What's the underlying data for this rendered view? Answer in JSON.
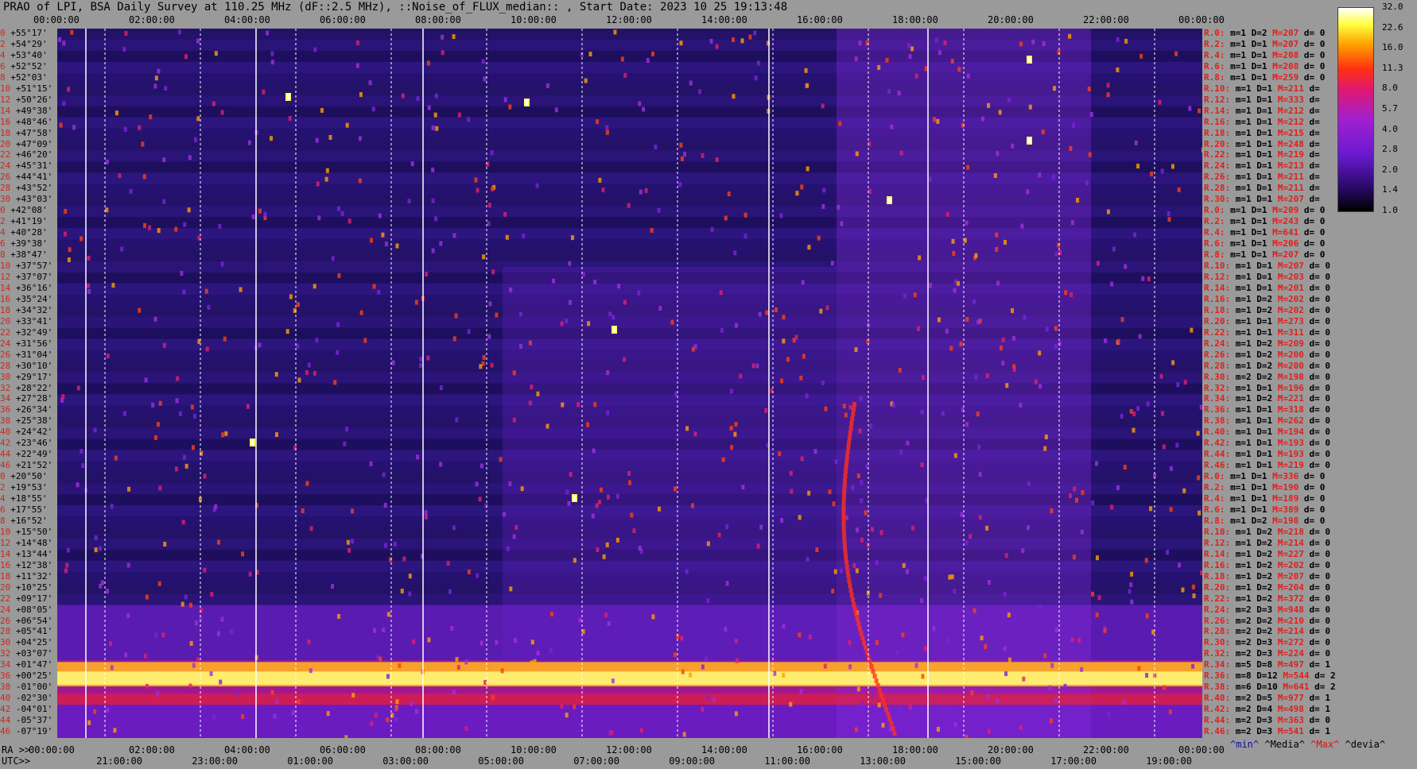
{
  "title": "PRAO of LPI, BSA Daily Survey at 110.25 MHz (dF::2.5 MHz), ::Noise_of_FLUX_median:: , Start Date: 2023 10 25 19:13:48",
  "top_ticks": [
    "00:00:00",
    "02:00:00",
    "04:00:00",
    "06:00:00",
    "08:00:00",
    "10:00:00",
    "12:00:00",
    "14:00:00",
    "16:00:00",
    "18:00:00",
    "20:00:00",
    "22:00:00",
    "00:00:00"
  ],
  "ra_prefix": "RA >>",
  "ra_ticks": [
    "00:00:00",
    "02:00:00",
    "04:00:00",
    "06:00:00",
    "08:00:00",
    "10:00:00",
    "12:00:00",
    "14:00:00",
    "16:00:00",
    "18:00:00",
    "20:00:00",
    "22:00:00",
    "00:00:00"
  ],
  "utc_prefix": "UTC>>",
  "utc_ticks": [
    "21:00:00",
    "23:00:00",
    "01:00:00",
    "03:00:00",
    "05:00:00",
    "07:00:00",
    "09:00:00",
    "11:00:00",
    "13:00:00",
    "15:00:00",
    "17:00:00",
    "19:00:00"
  ],
  "colorbar": {
    "labels": [
      "32.0",
      "22.6",
      "16.0",
      "11.3",
      "8.0",
      "5.7",
      "4.0",
      "2.8",
      "2.0",
      "1.4",
      "1.0"
    ]
  },
  "legend": {
    "min": "^min^",
    "median": "^Media^",
    "max": "^Max^",
    "dev": "^devia^"
  },
  "chart_data": {
    "type": "heatmap",
    "title": "PRAO of LPI, BSA Daily Survey at 110.25 MHz (dF::2.5 MHz), ::Noise_of_FLUX_median:: , Start Date: 2023 10 25 19:13:48",
    "x_ra_range": [
      "00:00:00",
      "00:00:00"
    ],
    "colorbar_range": [
      1.0,
      32.0
    ],
    "colorbar_scale": "log",
    "declinations": [
      "+55°17'",
      "+54°29'",
      "+53°40'",
      "+52°52'",
      "+52°03'",
      "+51°15'",
      "+50°26'",
      "+49°38'",
      "+48°46'",
      "+47°58'",
      "+47°09'",
      "+46°20'",
      "+45°31'",
      "+44°41'",
      "+43°52'",
      "+43°03'",
      "+42°08'",
      "+41°19'",
      "+40°28'",
      "+39°38'",
      "+38°47'",
      "+37°57'",
      "+37°07'",
      "+36°16'",
      "+35°24'",
      "+34°32'",
      "+33°41'",
      "+32°49'",
      "+31°56'",
      "+31°04'",
      "+30°10'",
      "+29°17'",
      "+28°22'",
      "+27°28'",
      "+26°34'",
      "+25°38'",
      "+24°42'",
      "+23°46'",
      "+22°49'",
      "+21°52'",
      "+20°50'",
      "+19°53'",
      "+18°55'",
      "+17°55'",
      "+16°52'",
      "+15°50'",
      "+14°48'",
      "+13°44'",
      "+12°38'",
      "+11°32'",
      "+10°25'",
      "+09°17'",
      "+08°05'",
      "+06°54'",
      "+05°41'",
      "+04°25'",
      "+03°07'",
      "+01°47'",
      "+00°25'",
      "-01°00'",
      "-02°30'",
      "-04°01'",
      "-05°37'",
      "-07°19'"
    ],
    "rows": [
      {
        "r": "R.0:",
        "m": "m=1",
        "d": "D=2",
        "M": "M=207",
        "dev": "d= 0"
      },
      {
        "r": "R.2:",
        "m": "m=1",
        "d": "D=1",
        "M": "M=207",
        "dev": "d= 0"
      },
      {
        "r": "R.4:",
        "m": "m=1",
        "d": "D=1",
        "M": "M=208",
        "dev": "d= 0"
      },
      {
        "r": "R.6:",
        "m": "m=1",
        "d": "D=1",
        "M": "M=208",
        "dev": "d= 0"
      },
      {
        "r": "R.8:",
        "m": "m=1",
        "d": "D=1",
        "M": "M=259",
        "dev": "d= 0"
      },
      {
        "r": "R.10:",
        "m": "m=1",
        "d": "D=1",
        "M": "M=211",
        "dev": "d="
      },
      {
        "r": "R.12:",
        "m": "m=1",
        "d": "D=1",
        "M": "M=333",
        "dev": "d="
      },
      {
        "r": "R.14:",
        "m": "m=1",
        "d": "D=1",
        "M": "M=212",
        "dev": "d="
      },
      {
        "r": "R.16:",
        "m": "m=1",
        "d": "D=1",
        "M": "M=212",
        "dev": "d="
      },
      {
        "r": "R.18:",
        "m": "m=1",
        "d": "D=1",
        "M": "M=215",
        "dev": "d="
      },
      {
        "r": "R.20:",
        "m": "m=1",
        "d": "D=1",
        "M": "M=248",
        "dev": "d="
      },
      {
        "r": "R.22:",
        "m": "m=1",
        "d": "D=1",
        "M": "M=219",
        "dev": "d="
      },
      {
        "r": "R.24:",
        "m": "m=1",
        "d": "D=1",
        "M": "M=213",
        "dev": "d="
      },
      {
        "r": "R.26:",
        "m": "m=1",
        "d": "D=1",
        "M": "M=211",
        "dev": "d="
      },
      {
        "r": "R.28:",
        "m": "m=1",
        "d": "D=1",
        "M": "M=211",
        "dev": "d="
      },
      {
        "r": "R.30:",
        "m": "m=1",
        "d": "D=1",
        "M": "M=207",
        "dev": "d="
      },
      {
        "r": "R.0:",
        "m": "m=1",
        "d": "D=1",
        "M": "M=209",
        "dev": "d= 0"
      },
      {
        "r": "R.2:",
        "m": "m=1",
        "d": "D=1",
        "M": "M=243",
        "dev": "d= 0"
      },
      {
        "r": "R.4:",
        "m": "m=1",
        "d": "D=1",
        "M": "M=641",
        "dev": "d= 0"
      },
      {
        "r": "R.6:",
        "m": "m=1",
        "d": "D=1",
        "M": "M=206",
        "dev": "d= 0"
      },
      {
        "r": "R.8:",
        "m": "m=1",
        "d": "D=1",
        "M": "M=207",
        "dev": "d= 0"
      },
      {
        "r": "R.10:",
        "m": "m=1",
        "d": "D=1",
        "M": "M=207",
        "dev": "d= 0"
      },
      {
        "r": "R.12:",
        "m": "m=1",
        "d": "D=1",
        "M": "M=203",
        "dev": "d= 0"
      },
      {
        "r": "R.14:",
        "m": "m=1",
        "d": "D=1",
        "M": "M=201",
        "dev": "d= 0"
      },
      {
        "r": "R.16:",
        "m": "m=1",
        "d": "D=2",
        "M": "M=202",
        "dev": "d= 0"
      },
      {
        "r": "R.18:",
        "m": "m=1",
        "d": "D=2",
        "M": "M=202",
        "dev": "d= 0"
      },
      {
        "r": "R.20:",
        "m": "m=1",
        "d": "D=1",
        "M": "M=273",
        "dev": "d= 0"
      },
      {
        "r": "R.22:",
        "m": "m=1",
        "d": "D=1",
        "M": "M=311",
        "dev": "d= 0"
      },
      {
        "r": "R.24:",
        "m": "m=1",
        "d": "D=2",
        "M": "M=209",
        "dev": "d= 0"
      },
      {
        "r": "R.26:",
        "m": "m=1",
        "d": "D=2",
        "M": "M=200",
        "dev": "d= 0"
      },
      {
        "r": "R.28:",
        "m": "m=1",
        "d": "D=2",
        "M": "M=200",
        "dev": "d= 0"
      },
      {
        "r": "R.30:",
        "m": "m=2",
        "d": "D=2",
        "M": "M=198",
        "dev": "d= 0"
      },
      {
        "r": "R.32:",
        "m": "m=1",
        "d": "D=1",
        "M": "M=196",
        "dev": "d= 0"
      },
      {
        "r": "R.34:",
        "m": "m=1",
        "d": "D=2",
        "M": "M=221",
        "dev": "d= 0"
      },
      {
        "r": "R.36:",
        "m": "m=1",
        "d": "D=1",
        "M": "M=318",
        "dev": "d= 0"
      },
      {
        "r": "R.38:",
        "m": "m=1",
        "d": "D=1",
        "M": "M=262",
        "dev": "d= 0"
      },
      {
        "r": "R.40:",
        "m": "m=1",
        "d": "D=1",
        "M": "M=194",
        "dev": "d= 0"
      },
      {
        "r": "R.42:",
        "m": "m=1",
        "d": "D=1",
        "M": "M=193",
        "dev": "d= 0"
      },
      {
        "r": "R.44:",
        "m": "m=1",
        "d": "D=1",
        "M": "M=193",
        "dev": "d= 0"
      },
      {
        "r": "R.46:",
        "m": "m=1",
        "d": "D=1",
        "M": "M=219",
        "dev": "d= 0"
      },
      {
        "r": "R.0:",
        "m": "m=1",
        "d": "D=1",
        "M": "M=336",
        "dev": "d= 0"
      },
      {
        "r": "R.2:",
        "m": "m=1",
        "d": "D=1",
        "M": "M=190",
        "dev": "d= 0"
      },
      {
        "r": "R.4:",
        "m": "m=1",
        "d": "D=1",
        "M": "M=189",
        "dev": "d= 0"
      },
      {
        "r": "R.6:",
        "m": "m=1",
        "d": "D=1",
        "M": "M=389",
        "dev": "d= 0"
      },
      {
        "r": "R.8:",
        "m": "m=1",
        "d": "D=2",
        "M": "M=198",
        "dev": "d= 0"
      },
      {
        "r": "R.10:",
        "m": "m=1",
        "d": "D=2",
        "M": "M=218",
        "dev": "d= 0"
      },
      {
        "r": "R.12:",
        "m": "m=1",
        "d": "D=2",
        "M": "M=214",
        "dev": "d= 0"
      },
      {
        "r": "R.14:",
        "m": "m=1",
        "d": "D=2",
        "M": "M=227",
        "dev": "d= 0"
      },
      {
        "r": "R.16:",
        "m": "m=1",
        "d": "D=2",
        "M": "M=202",
        "dev": "d= 0"
      },
      {
        "r": "R.18:",
        "m": "m=1",
        "d": "D=2",
        "M": "M=207",
        "dev": "d= 0"
      },
      {
        "r": "R.20:",
        "m": "m=1",
        "d": "D=2",
        "M": "M=204",
        "dev": "d= 0"
      },
      {
        "r": "R.22:",
        "m": "m=1",
        "d": "D=2",
        "M": "M=372",
        "dev": "d= 0"
      },
      {
        "r": "R.24:",
        "m": "m=2",
        "d": "D=3",
        "M": "M=948",
        "dev": "d= 0"
      },
      {
        "r": "R.26:",
        "m": "m=2",
        "d": "D=2",
        "M": "M=210",
        "dev": "d= 0"
      },
      {
        "r": "R.28:",
        "m": "m=2",
        "d": "D=2",
        "M": "M=214",
        "dev": "d= 0"
      },
      {
        "r": "R.30:",
        "m": "m=2",
        "d": "D=3",
        "M": "M=272",
        "dev": "d= 0"
      },
      {
        "r": "R.32:",
        "m": "m=2",
        "d": "D=3",
        "M": "M=224",
        "dev": "d= 0"
      },
      {
        "r": "R.34:",
        "m": "m=5",
        "d": "D=8",
        "M": "M=497",
        "dev": "d= 1"
      },
      {
        "r": "R.36:",
        "m": "m=8",
        "d": "D=12",
        "M": "M=544",
        "dev": "d= 2"
      },
      {
        "r": "R.38:",
        "m": "m=6",
        "d": "D=10",
        "M": "M=641",
        "dev": "d= 2"
      },
      {
        "r": "R.40:",
        "m": "m=2",
        "d": "D=5",
        "M": "M=977",
        "dev": "d= 1"
      },
      {
        "r": "R.42:",
        "m": "m=2",
        "d": "D=4",
        "M": "M=498",
        "dev": "d= 1"
      },
      {
        "r": "R.44:",
        "m": "m=2",
        "d": "D=3",
        "M": "M=363",
        "dev": "d= 0"
      },
      {
        "r": "R.46:",
        "m": "m=2",
        "d": "D=3",
        "M": "M=541",
        "dev": "d= 1"
      }
    ],
    "row_index_labels": [
      "0",
      "2",
      "4",
      "6",
      "8",
      "10",
      "12",
      "14",
      "16",
      "18",
      "20",
      "22",
      "24",
      "26",
      "28",
      "30",
      "0",
      "2",
      "4",
      "6",
      "8",
      "10",
      "12",
      "14",
      "16",
      "18",
      "20",
      "22",
      "24",
      "26",
      "28",
      "30",
      "32",
      "34",
      "36",
      "38",
      "40",
      "42",
      "44",
      "46",
      "0",
      "2",
      "4",
      "6",
      "8",
      "10",
      "12",
      "14",
      "16",
      "18",
      "20",
      "22",
      "24",
      "26",
      "28",
      "30",
      "32",
      "34",
      "36",
      "38",
      "40",
      "42",
      "44",
      "46"
    ]
  }
}
